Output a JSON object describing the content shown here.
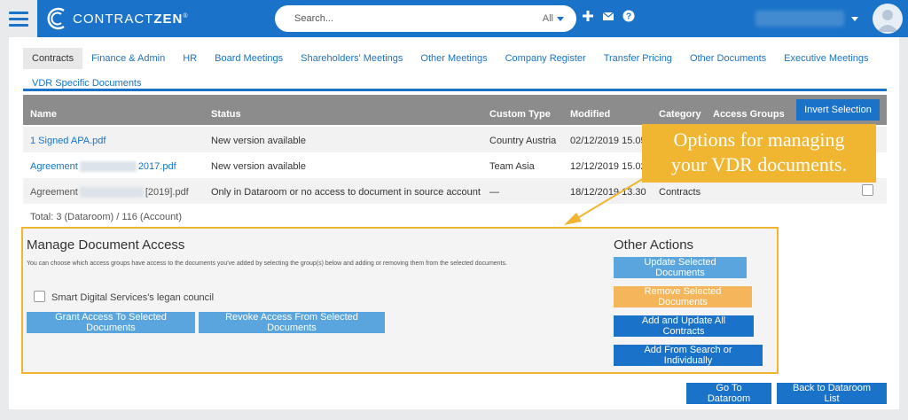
{
  "header": {
    "logo_light": "CONTRACT",
    "logo_bold": "ZEN",
    "logo_reg": "®",
    "search_placeholder": "Search...",
    "search_scope": "All",
    "icons": [
      "plus-icon",
      "envelope-icon",
      "question-icon"
    ]
  },
  "tabs": [
    "Contracts",
    "Finance & Admin",
    "HR",
    "Board Meetings",
    "Shareholders' Meetings",
    "Other Meetings",
    "Company Register",
    "Transfer Pricing",
    "Other Documents",
    "Executive Meetings",
    "VDR Specific Documents"
  ],
  "table": {
    "headers": {
      "name": "Name",
      "status": "Status",
      "custom_type": "Custom Type",
      "modified": "Modified",
      "category": "Category",
      "access_groups": "Access Groups"
    },
    "invert_label": "Invert Selection",
    "rows": [
      {
        "name": "1 Signed APA.pdf",
        "status": "New version available",
        "custom_type": "Country Austria",
        "modified": "02/12/2019 15.05"
      },
      {
        "name_a": "Agreement",
        "name_b": "2017.pdf",
        "status": "New version available",
        "custom_type": "Team Asia",
        "modified": "12/12/2019 15.02"
      },
      {
        "name_a": "Agreement",
        "name_b": "[2019].pdf",
        "status": "Only in Dataroom or no access to document in source account",
        "custom_type": "—",
        "modified": "18/12/2019 13.30",
        "category": "Contracts"
      }
    ],
    "total": "Total: 3 (Dataroom) / 116 (Account)"
  },
  "tooltip": {
    "line1": "Options for managing",
    "line2": "your VDR documents."
  },
  "manage": {
    "title": "Manage Document Access",
    "description": "You can choose which access groups have access to the documents you've added by selecting the group(s) below and adding or removing them from the selected documents.",
    "group_label": "Smart Digital Services's legan council",
    "grant_label": "Grant Access To Selected Documents",
    "revoke_label": "Revoke Access From Selected Documents"
  },
  "other_actions": {
    "title": "Other Actions",
    "update_selected": "Update Selected Documents",
    "remove_selected": "Remove Selected Documents",
    "add_update_all": "Add and Update All Contracts",
    "add_from_search": "Add From Search or Individually"
  },
  "footer": {
    "go_to_dataroom": "Go To Dataroom",
    "back_to_list": "Back to Dataroom List"
  },
  "colors": {
    "brand_blue": "#1a73c8",
    "highlight_yellow": "#f0b632",
    "remove_orange": "#f5b55a"
  }
}
